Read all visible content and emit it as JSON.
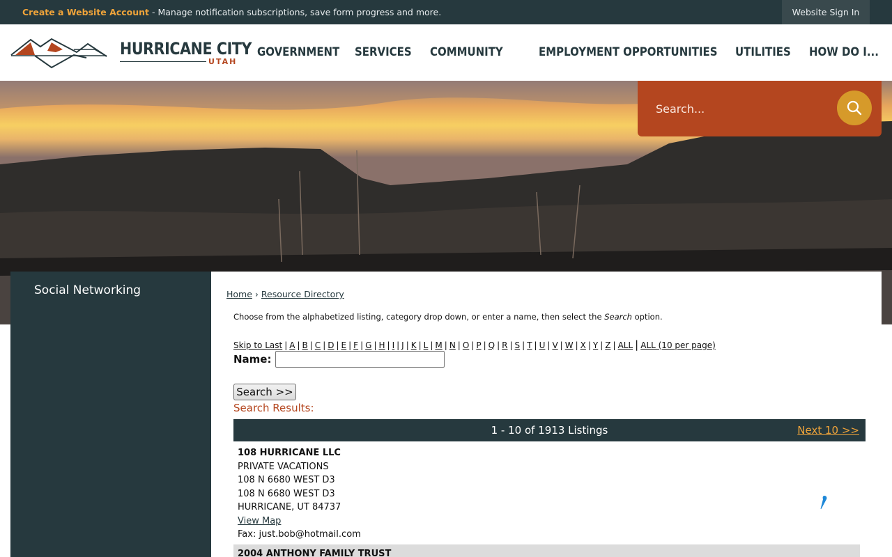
{
  "topbar": {
    "account_link": "Create a Website Account",
    "account_message": " - Manage notification subscriptions, save form progress and more.",
    "signin_label": "Website Sign In"
  },
  "logo": {
    "line1": "HURRICANE CITY",
    "line2": "UTAH"
  },
  "nav": [
    "GOVERNMENT",
    "SERVICES",
    "COMMUNITY",
    "EMPLOYMENT OPPORTUNITIES",
    "UTILITIES",
    "HOW DO I..."
  ],
  "search": {
    "placeholder": "Search..."
  },
  "sidebar": {
    "items": [
      {
        "label": "Social Networking"
      }
    ]
  },
  "breadcrumb": {
    "home": "Home",
    "separator": "›",
    "current": "Resource Directory"
  },
  "intro": {
    "before": "Choose from the alphabetized listing, category drop down, or enter a name, then select the ",
    "emphasis": "Search",
    "after": " option."
  },
  "alpha": {
    "skip_last": "Skip to Last",
    "letters": [
      "A",
      "B",
      "C",
      "D",
      "E",
      "F",
      "G",
      "H",
      "I",
      "J",
      "K",
      "L",
      "M",
      "N",
      "O",
      "P",
      "Q",
      "R",
      "S",
      "T",
      "U",
      "V",
      "W",
      "X",
      "Y",
      "Z",
      "ALL"
    ],
    "all_per_page": "ALL (10 per page)"
  },
  "form": {
    "name_label": "Name:",
    "name_value": "",
    "search_button": "Search >>"
  },
  "results": {
    "label": "Search Results:",
    "count_text": "1 - 10 of 1913 Listings",
    "next_label": "Next 10 >>"
  },
  "listings": [
    {
      "name": "108 HURRICANE LLC",
      "dba": "PRIVATE VACATIONS",
      "address1": "108 N 6680 WEST D3",
      "address2": "108 N 6680 WEST D3",
      "city": "HURRICANE, UT 84737",
      "map_link": "View Map",
      "fax": "Fax: just.bob@hotmail.com"
    },
    {
      "name": "2004 ANTHONY FAMILY TRUST"
    }
  ],
  "colors": {
    "dark": "#26393e",
    "accent": "#b4461f",
    "gold": "#d69a2a",
    "link_orange": "#f0a43a"
  }
}
